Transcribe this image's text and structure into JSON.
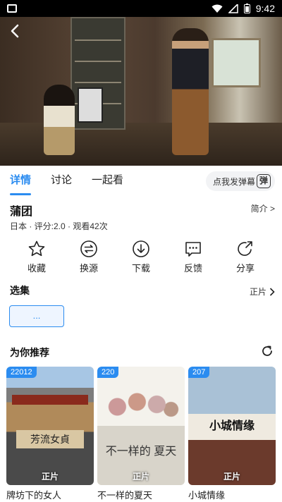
{
  "status_bar": {
    "time": "9:42"
  },
  "tabs": [
    {
      "label": "详情",
      "active": true
    },
    {
      "label": "讨论",
      "active": false
    },
    {
      "label": "一起看",
      "active": false
    }
  ],
  "danmu": {
    "label": "点我发弹幕",
    "icon_char": "弹"
  },
  "movie": {
    "title": "蒲团",
    "intro_label": "简介 >",
    "meta": "日本 · 评分:2.0 · 观看42次"
  },
  "actions": [
    {
      "label": "收藏",
      "icon": "star-icon"
    },
    {
      "label": "换源",
      "icon": "switch-source-icon"
    },
    {
      "label": "下载",
      "icon": "download-icon"
    },
    {
      "label": "反馈",
      "icon": "feedback-icon"
    },
    {
      "label": "分享",
      "icon": "share-icon"
    }
  ],
  "episodes": {
    "section_title": "选集",
    "right_label": "正片",
    "current": "..."
  },
  "recommend": {
    "section_title": "为你推荐",
    "items": [
      {
        "badge": "22012",
        "tag": "正片",
        "name": "牌坊下的女人",
        "poster_text": "芳流女貞"
      },
      {
        "badge": "220",
        "tag": "正片",
        "name": "不一样的夏天",
        "poster_text": "不一样的 夏天"
      },
      {
        "badge": "207",
        "tag": "正片",
        "name": "小城情缘",
        "poster_text": "小城情缘"
      }
    ]
  },
  "colors": {
    "accent": "#2b8cf0"
  }
}
